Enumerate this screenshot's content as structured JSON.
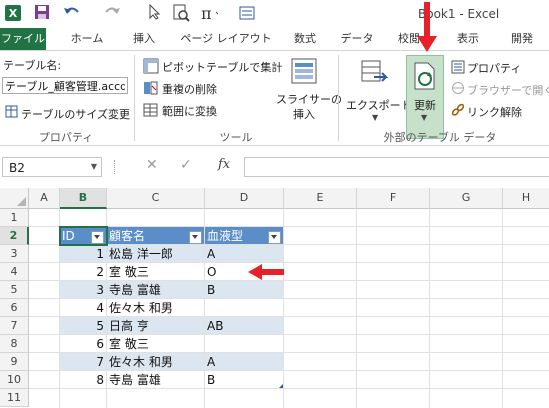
{
  "window": {
    "title": "Book1 - Excel"
  },
  "tabs": [
    "ファイル",
    "ホーム",
    "挿入",
    "ページ レイアウト",
    "数式",
    "データ",
    "校閲",
    "表示",
    "開発"
  ],
  "ribbon": {
    "table_name_label": "テーブル名:",
    "table_name_value": "テーブル_顧客管理.accdb",
    "resize_table": "テーブルのサイズ変更",
    "properties_group": "プロパティ",
    "pivot": "ピボットテーブルで集計",
    "remove_duplicates": "重複の削除",
    "convert_to_range": "範囲に変換",
    "slicer_line1": "スライサーの",
    "slicer_line2": "挿入",
    "tools_group": "ツール",
    "export": "エクスポート",
    "refresh": "更新",
    "properties": "プロパティ",
    "open_in_browser": "ブラウザーで開く",
    "unlink": "リンク解除",
    "external_group": "外部のテーブル データ"
  },
  "formula_bar": {
    "name_box": "B2",
    "fx": "fx",
    "formula": ""
  },
  "sheet": {
    "columns": [
      "A",
      "B",
      "C",
      "D",
      "E",
      "F",
      "G",
      "H"
    ],
    "rows": [
      "1",
      "2",
      "3",
      "4",
      "5",
      "6",
      "7",
      "8",
      "9",
      "10",
      "11"
    ],
    "table_headers": [
      "ID",
      "顧客名",
      "血液型"
    ],
    "table_rows": [
      {
        "id": "1",
        "name": "松島 洋一郎",
        "blood": "A"
      },
      {
        "id": "2",
        "name": "室 敬三",
        "blood": "O"
      },
      {
        "id": "3",
        "name": "寺島 富雄",
        "blood": "B"
      },
      {
        "id": "4",
        "name": "佐々木 和男",
        "blood": ""
      },
      {
        "id": "5",
        "name": "日高 亨",
        "blood": "AB"
      },
      {
        "id": "6",
        "name": "室 敬三",
        "blood": ""
      },
      {
        "id": "7",
        "name": "佐々木 和男",
        "blood": "A"
      },
      {
        "id": "8",
        "name": "寺島 富雄",
        "blood": "B"
      }
    ]
  },
  "colors": {
    "accent": "#217346",
    "table_header": "#5b8ec9",
    "table_band": "#dce6f1",
    "arrow": "#e8202a"
  }
}
